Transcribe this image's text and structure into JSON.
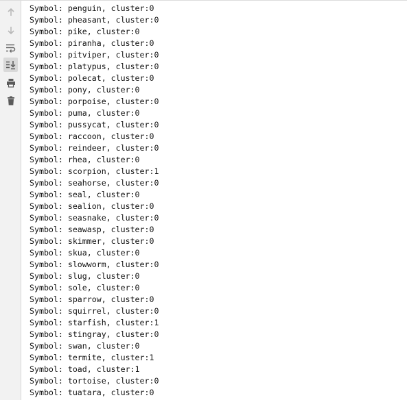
{
  "toolbar": {
    "items": [
      {
        "icon": "arrow-up-icon",
        "label": "Up the Stack Trace",
        "active": false
      },
      {
        "icon": "arrow-down-icon",
        "label": "Down the Stack Trace",
        "active": false
      },
      {
        "icon": "soft-wrap-icon",
        "label": "Soft-Wrap",
        "active": false
      },
      {
        "icon": "scroll-to-end-icon",
        "label": "Scroll to the end",
        "active": true
      },
      {
        "icon": "print-icon",
        "label": "Print",
        "active": false
      },
      {
        "icon": "trash-icon",
        "label": "Clear All",
        "active": false
      }
    ]
  },
  "console": {
    "lines": [
      "Symbol: penguin, cluster:0",
      "Symbol: pheasant, cluster:0",
      "Symbol: pike, cluster:0",
      "Symbol: piranha, cluster:0",
      "Symbol: pitviper, cluster:0",
      "Symbol: platypus, cluster:0",
      "Symbol: polecat, cluster:0",
      "Symbol: pony, cluster:0",
      "Symbol: porpoise, cluster:0",
      "Symbol: puma, cluster:0",
      "Symbol: pussycat, cluster:0",
      "Symbol: raccoon, cluster:0",
      "Symbol: reindeer, cluster:0",
      "Symbol: rhea, cluster:0",
      "Symbol: scorpion, cluster:1",
      "Symbol: seahorse, cluster:0",
      "Symbol: seal, cluster:0",
      "Symbol: sealion, cluster:0",
      "Symbol: seasnake, cluster:0",
      "Symbol: seawasp, cluster:0",
      "Symbol: skimmer, cluster:0",
      "Symbol: skua, cluster:0",
      "Symbol: slowworm, cluster:0",
      "Symbol: slug, cluster:0",
      "Symbol: sole, cluster:0",
      "Symbol: sparrow, cluster:0",
      "Symbol: squirrel, cluster:0",
      "Symbol: starfish, cluster:1",
      "Symbol: stingray, cluster:0",
      "Symbol: swan, cluster:0",
      "Symbol: termite, cluster:1",
      "Symbol: toad, cluster:1",
      "Symbol: tortoise, cluster:0",
      "Symbol: tuatara, cluster:0"
    ]
  }
}
